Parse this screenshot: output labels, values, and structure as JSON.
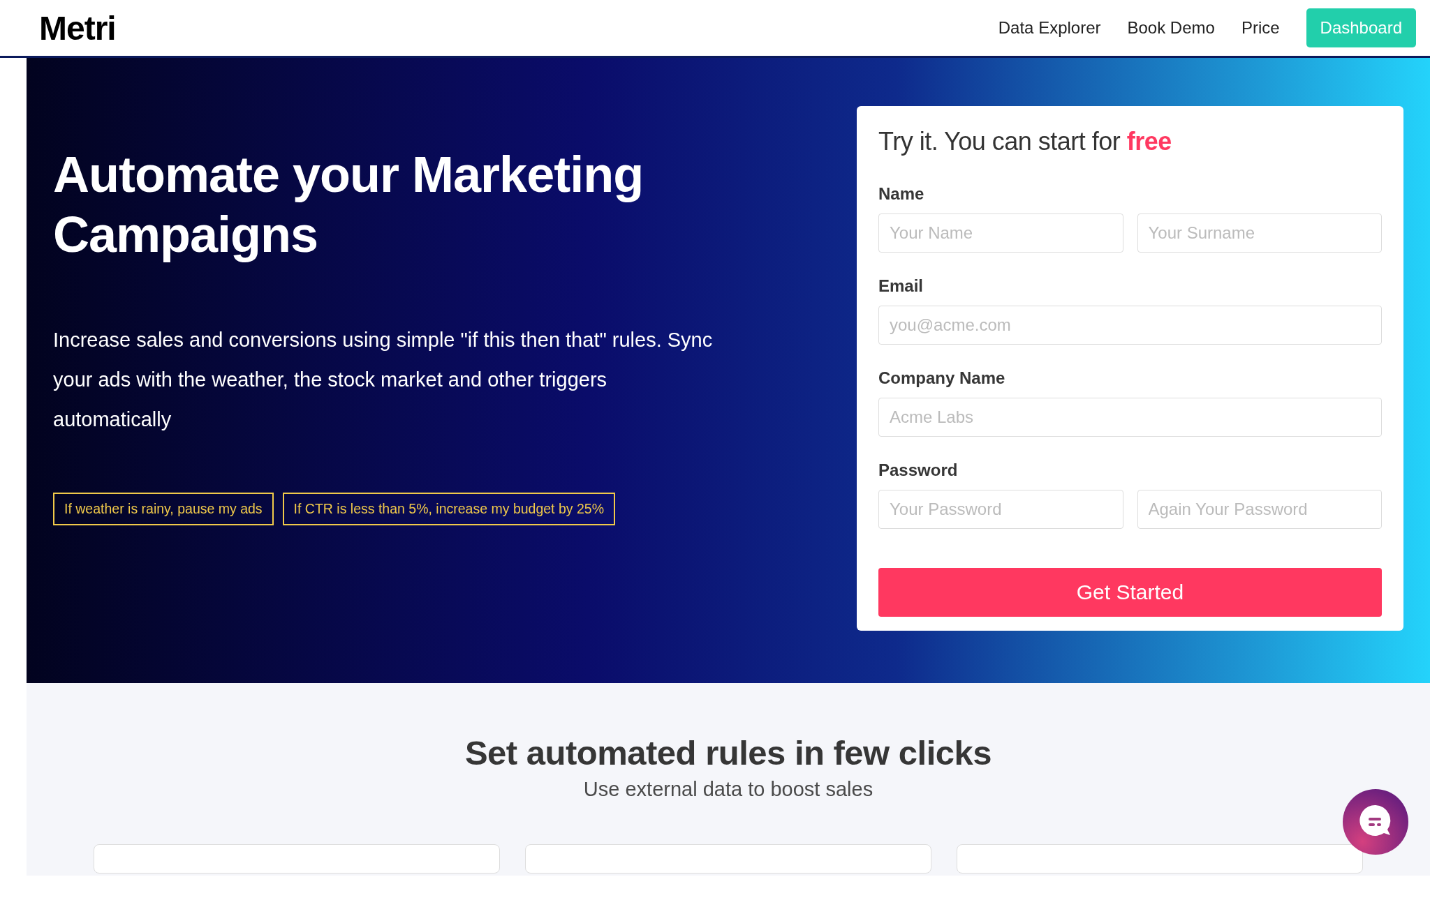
{
  "header": {
    "logo": "Metri",
    "nav": [
      {
        "label": "Data Explorer",
        "kind": "link"
      },
      {
        "label": "Book Demo",
        "kind": "link"
      },
      {
        "label": "Price",
        "kind": "link"
      },
      {
        "label": "Dashboard",
        "kind": "button"
      }
    ]
  },
  "hero": {
    "title": "Automate your Marketing Campaigns",
    "description": "Increase sales and conversions using simple \"if this then that\" rules. Sync your ads with the weather, the stock market and other triggers automatically",
    "rules": [
      "If weather is rainy, pause my ads",
      "If CTR is less than 5%, increase my budget by 25%"
    ]
  },
  "signup_form": {
    "title": "Try it. You can start for **free**",
    "groups": [
      {
        "label": "Name",
        "fields": [
          {
            "placeholder": "Your Name"
          },
          {
            "placeholder": "Your Surname"
          }
        ]
      },
      {
        "label": "Email",
        "fields": [
          {
            "placeholder": "you@acme.com"
          }
        ]
      },
      {
        "label": "Company Name",
        "fields": [
          {
            "placeholder": "Acme Labs"
          }
        ]
      },
      {
        "label": "Password",
        "fields": [
          {
            "placeholder": "Your Password"
          },
          {
            "placeholder": "Again Your Password"
          }
        ]
      }
    ],
    "submit": "Get Started"
  },
  "features": {
    "title": "Set automated rules in few clicks",
    "subtitle": "Use external data to boost sales",
    "cards": [
      {
        "kind": "card"
      },
      {
        "kind": "card"
      },
      {
        "kind": "card"
      }
    ]
  }
}
